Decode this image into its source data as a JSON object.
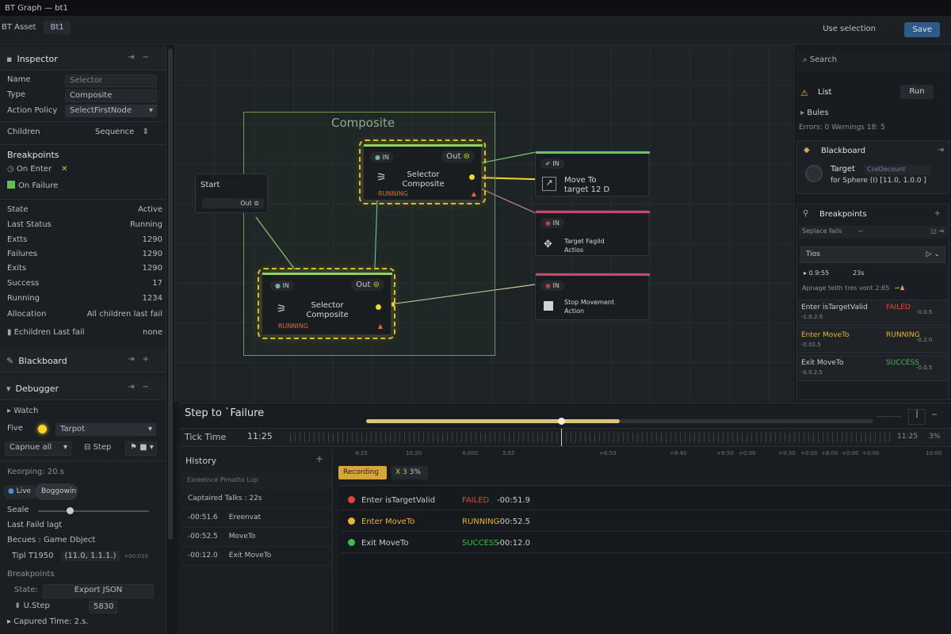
{
  "window": {
    "title": "BT Graph — bt1"
  },
  "toolbar": {
    "asset_label": "BT Asset",
    "asset_name": "Bt1",
    "use_selection": "Use selection",
    "save": "Save"
  },
  "inspector": {
    "title": "Inspector",
    "fields": [
      {
        "label": "Name",
        "value": "Selector"
      },
      {
        "label": "Type",
        "value": "Composite"
      },
      {
        "label": "Action Policy",
        "value": "SelectFirstNode"
      }
    ],
    "children_label": "Children",
    "children_value": "Sequence",
    "breakpoints_title": "Breakpoints",
    "on_enter": "On Enter",
    "on_failure": "On Failure",
    "stats": [
      {
        "label": "State",
        "value": "Active"
      },
      {
        "label": "Last Status",
        "value": "Running"
      },
      {
        "label": "Extts",
        "value": "1290"
      },
      {
        "label": "Failures",
        "value": "1290"
      },
      {
        "label": "Exits",
        "value": "1290"
      },
      {
        "label": "Success",
        "value": "17"
      },
      {
        "label": "Running",
        "value": "1234"
      },
      {
        "label": "Allocation",
        "value": "All children last fail"
      },
      {
        "label": "Echildren Last fail",
        "value": "none"
      }
    ]
  },
  "blackboard_section": {
    "title": "Blackboard"
  },
  "debugger": {
    "title": "Debugger",
    "watch": "Watch",
    "five": "Five",
    "target_select": "Tarpot",
    "capture": "Capnue all",
    "step": "Step",
    "recording": "Keorping: 20.s",
    "live": "Live",
    "boggowin": "Boggowin",
    "scale": "Seale",
    "last_fail": "Last Faild lagt",
    "becues": "Becues : Game Dbject",
    "tipt": "Tipl T1950",
    "tipt_val": "(11.0, 1.1.1.)",
    "tipt_small": "+00:010",
    "breakpoints": "Breakpoints",
    "state": "State:",
    "export": "Export JSON",
    "ustep": "U.Step",
    "ustep_val": "5830",
    "captured": "Capured Time: 2.s."
  },
  "canvas": {
    "composite_group": "Composite",
    "start": {
      "label": "Start",
      "out": "Out"
    },
    "selector_top": {
      "in": "IN",
      "out": "Out",
      "label1": "Selector",
      "label2": "Composite",
      "status": "RUNNING"
    },
    "selector_bottom": {
      "in": "IN",
      "out": "Out",
      "label1": "Selector",
      "label2": "Composite",
      "status": "RUNNING"
    },
    "move_to": {
      "in": "IN",
      "label1": "Move To",
      "label2": "target 12 D"
    },
    "target_failed": {
      "in": "IN",
      "label1": "Target Fagild",
      "label2": "Actios"
    },
    "stop_movement": {
      "in": "IN",
      "label1": "Stop Movement",
      "label2": "Action"
    }
  },
  "right_panel": {
    "search": "Search",
    "list": "List",
    "run": "Run",
    "rules": "Bules",
    "errors": "Errors: 0   Wernings  18:  5",
    "blackboard": "Blackboard",
    "target_label": "Target",
    "target_chip": "CseDecount",
    "for_sphere": "for Sphere  (I)   [11.0, 1.0.0 ]",
    "breakpoints": "Breakpoints",
    "replace_fails": "Seplace fails",
    "tios": "Tios",
    "time_a": "0.9:55",
    "time_b": "23s",
    "apnage": "Apnage teith tres vont 2:85",
    "log": [
      {
        "event": "Enter isTargetValid",
        "status": "FAILED",
        "time": "-1:0.2.5",
        "time2": "-0.0.5"
      },
      {
        "event": "Enter MoveTo",
        "status": "RUNNING",
        "time": "-0.02.5",
        "time2": "-0.2.0"
      },
      {
        "event": "Exit MoveTo",
        "status": "SUCCESS",
        "time": "-0.0.2.5",
        "time2": "-0.0.5"
      }
    ]
  },
  "bottom": {
    "step_title": "Step to `Failure",
    "scrubber_progress": 0.5,
    "tick_time_label": "Tick Time",
    "tick_time_value": "11:25",
    "tick_end": "11:25",
    "tick_pct": "3%",
    "ticks": [
      "4:25",
      "10:20",
      "4:000",
      "5:55",
      "+6:50",
      "+8:40",
      "+8:50",
      "+0:00",
      "+9:30",
      "+0:00",
      "+8:00",
      "+0:00",
      "+0:00",
      "10:00"
    ],
    "history_title": "History",
    "history_sub": "Exreeince Pimatto Lup",
    "captured_talks": "Captaired Talks : 22s",
    "history_rows": [
      {
        "time": "-00:51.6",
        "label": "Ereenvat"
      },
      {
        "time": "-00:52.5",
        "label": "MoveTo"
      },
      {
        "time": "-00:12.0",
        "label": "Exit MoveTo"
      }
    ],
    "recording_badge": "Recording",
    "speed": "X 3",
    "speed_pct": "3%",
    "events": [
      {
        "label": "Enter isTargetValid",
        "status": "FAILED",
        "time": "-00:51.9",
        "color": "#e0463e"
      },
      {
        "label": "Enter MoveTo",
        "status": "RUNNING",
        "time": "-00:52.5",
        "color": "#e6b532"
      },
      {
        "label": "Exit MoveTo",
        "status": "SUCCESS",
        "time": "-00:12.0",
        "color": "#3fb950"
      }
    ]
  },
  "colors": {
    "accent": "#2f5a86",
    "yellow": "#d8c12a",
    "green": "#5fbf52",
    "red": "#e0463e",
    "pink": "#c7476a"
  }
}
